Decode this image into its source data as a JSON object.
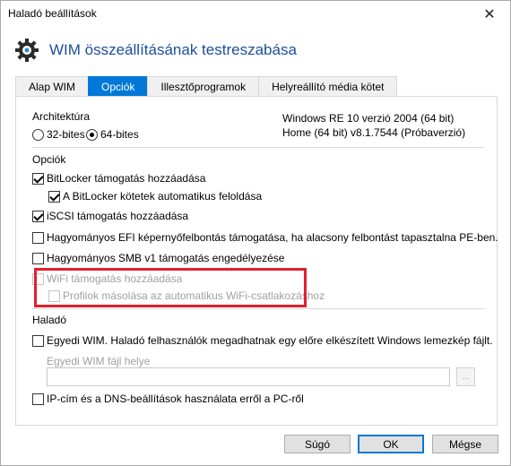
{
  "window": {
    "title": "Haladó beállítások",
    "close_glyph": "✕"
  },
  "header": {
    "title": "WIM összeállításának testreszabása",
    "icon": "gear-icon"
  },
  "tabs": [
    {
      "label": "Alap WIM"
    },
    {
      "label": "Opciók"
    },
    {
      "label": "Illesztőprogramok"
    },
    {
      "label": "Helyreállító média kötet"
    }
  ],
  "architecture": {
    "label": "Architektúra",
    "option_32": "32-bites",
    "option_64": "64-bites",
    "info_line1": "Windows RE 10 verzió 2004 (64 bit)",
    "info_line2": "Home (64 bit) v8.1.7544 (Próbaverzió)"
  },
  "options": {
    "label": "Opciók",
    "bitlocker": "BitLocker támogatás hozzáadása",
    "bitlocker_unlock": "A BitLocker kötetek automatikus feloldása",
    "iscsi": "iSCSI támogatás hozzáadása",
    "efi": "Hagyományos EFI képernyőfelbontás támogatása, ha alacsony felbontást tapasztalna PE-ben.",
    "smb": "Hagyományos SMB v1 támogatás engedélyezése",
    "wifi": "WiFi támogatás hozzáadása",
    "wifi_profiles": "Profilok másolása az automatikus WiFi-csatlakozáshoz"
  },
  "advanced": {
    "label": "Haladó",
    "custom_wim": "Egyedi WIM. Haladó felhasználók megadhatnak egy előre elkészített Windows lemezkép fájlt.",
    "custom_wim_path_label": "Egyedi WIM fájl helye",
    "custom_wim_path_value": "",
    "browse": "...",
    "ip_dns": "IP-cím és a DNS-beállítások használata erről a PC-ről"
  },
  "buttons": {
    "help": "Súgó",
    "ok": "OK",
    "cancel": "Mégse"
  },
  "colors": {
    "accent": "#0078d7",
    "title_blue": "#1a4e9c",
    "highlight": "#e2202a"
  }
}
